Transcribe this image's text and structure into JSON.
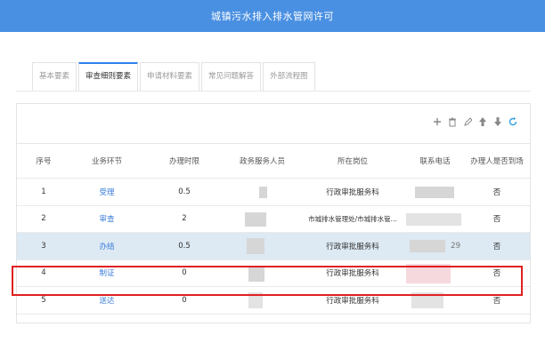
{
  "header": {
    "title": "城镇污水排入排水管网许可"
  },
  "tabs": [
    {
      "label": "基本要素",
      "active": false
    },
    {
      "label": "审查细则要素",
      "active": true
    },
    {
      "label": "申请材料要素",
      "active": false
    },
    {
      "label": "常见问题解答",
      "active": false
    },
    {
      "label": "外部流程图",
      "active": false
    }
  ],
  "toolbar": {
    "icons": [
      "plus-icon",
      "trash-icon",
      "edit-icon",
      "arrow-up-icon",
      "arrow-down-icon",
      "refresh-icon"
    ]
  },
  "table": {
    "columns": [
      "序号",
      "业务环节",
      "办理时限",
      "政务服务人员",
      "所在岗位",
      "联系电话",
      "办理人是否到场"
    ],
    "rows": [
      {
        "no": "1",
        "step": "受理",
        "limit": "0.5",
        "person": "",
        "post": "行政审批服务科",
        "phone": "",
        "present": "否"
      },
      {
        "no": "2",
        "step": "审查",
        "limit": "2",
        "person": "",
        "post": "市城排水管理处/市城排水管...",
        "phone": "",
        "present": "否"
      },
      {
        "no": "3",
        "step": "办结",
        "limit": "0.5",
        "person": "",
        "post": "行政审批服务科",
        "phone": "29",
        "present": "否"
      },
      {
        "no": "4",
        "step": "制证",
        "limit": "0",
        "person": "",
        "post": "行政审批服务科",
        "phone": "",
        "present": "否"
      },
      {
        "no": "5",
        "step": "送达",
        "limit": "0",
        "person": "",
        "post": "行政审批服务科",
        "phone": "",
        "present": "否"
      }
    ],
    "highlighted_row": "4"
  },
  "colors": {
    "header_bg": "#4a90e2",
    "accent": "#2f80ed",
    "link": "#3b7dd8",
    "selected_row": "#dde9f3",
    "annotation": "#e02020"
  }
}
